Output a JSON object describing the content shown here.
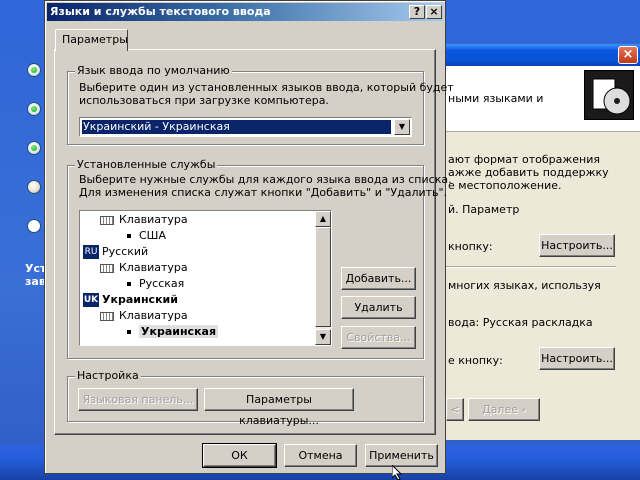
{
  "colors": {
    "desktop": "#3a6fd6",
    "title_active": "#0a246a",
    "selection": "#0a246a",
    "face": "#d4d0c8"
  },
  "desktop": {
    "text_line1": "Уст",
    "text_line2": "зав"
  },
  "back_dialog": {
    "header_text": "ными языками и",
    "para1": [
      "ают формат отображения",
      "ажже добавить поддержку",
      "е местоположение."
    ],
    "line_param": "й. Параметр",
    "line_button": "кнопку:",
    "settings_button_1": "Настроить...",
    "para2": "многих языках, используя",
    "line_input": "вода: Русская раскладка",
    "line_button_2": "е кнопку:",
    "settings_button_2": "Настроить...",
    "next_button": "Далее",
    "back_button_partial": "<"
  },
  "dialog": {
    "title": "Языки и службы текстового ввода",
    "help_btn": "?",
    "close_btn": "×",
    "tab": "Параметры",
    "default_lang_group": "Язык ввода по умолчанию",
    "default_lang_desc1": "Выберите один из установленных языков ввода, который будет",
    "default_lang_desc2": "использоваться при загрузке компьютера.",
    "default_lang_value": "Украинский - Украинская",
    "services_group": "Установленные службы",
    "services_desc1": "Выберите нужные службы для каждого языка ввода из списка.",
    "services_desc2": "Для изменения списка служат кнопки \"Добавить\" и \"Удалить\".",
    "tree": [
      {
        "type": "kb",
        "label": "Клавиатура"
      },
      {
        "type": "bullet",
        "label": "США"
      },
      {
        "type": "lang",
        "code": "RU",
        "label": "Русский"
      },
      {
        "type": "kb",
        "label": "Клавиатура"
      },
      {
        "type": "bullet",
        "label": "Русская"
      },
      {
        "type": "lang",
        "code": "UK",
        "label": "Украинский"
      },
      {
        "type": "kb",
        "label": "Клавиатура"
      },
      {
        "type": "bullet",
        "label": "Украинская"
      }
    ],
    "add_button": "Добавить...",
    "remove_button": "Удалить",
    "props_button": "Свойства...",
    "settings_group": "Настройка",
    "langbar_button": "Языковая панель...",
    "keyparams_button": "Параметры клавиатуры...",
    "ok_button": "ОК",
    "cancel_button": "Отмена",
    "apply_button": "Применить"
  }
}
